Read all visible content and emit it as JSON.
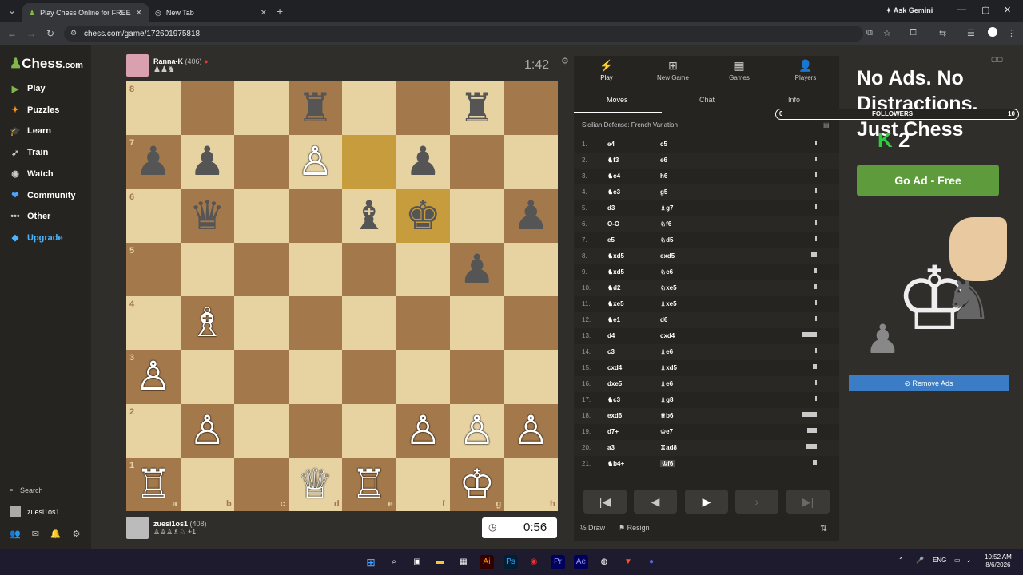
{
  "browser": {
    "tabs": [
      {
        "title": "Play Chess Online for FREE",
        "active": true
      },
      {
        "title": "New Tab",
        "active": false
      }
    ],
    "url": "chess.com/game/172601975818",
    "gemini": "Ask Gemini"
  },
  "sidebar": {
    "logo_main": "Chess",
    "logo_suffix": ".com",
    "items": [
      {
        "label": "Play",
        "icon": "play-icon"
      },
      {
        "label": "Puzzles",
        "icon": "puzzle-icon"
      },
      {
        "label": "Learn",
        "icon": "learn-icon"
      },
      {
        "label": "Train",
        "icon": "train-icon"
      },
      {
        "label": "Watch",
        "icon": "watch-icon"
      },
      {
        "label": "Community",
        "icon": "community-icon"
      },
      {
        "label": "Other",
        "icon": "more-icon"
      },
      {
        "label": "Upgrade",
        "icon": "diamond-icon"
      }
    ],
    "search": "Search",
    "username": "zuesi1os1"
  },
  "top_player": {
    "name": "Ranna-K",
    "rating": "(406)",
    "clock": "1:42"
  },
  "bottom_player": {
    "name": "zuesi1os1",
    "rating": "(408)",
    "extra": "+1",
    "clock": "0:56"
  },
  "board": {
    "ranks": [
      "8",
      "7",
      "6",
      "5",
      "4",
      "3",
      "2",
      "1"
    ],
    "files": [
      "a",
      "b",
      "c",
      "d",
      "e",
      "f",
      "g",
      "h"
    ],
    "highlight": [
      "e7",
      "f6"
    ],
    "pieces": [
      {
        "sq": "d8",
        "p": "♜",
        "c": "b"
      },
      {
        "sq": "g8",
        "p": "♜",
        "c": "b"
      },
      {
        "sq": "a7",
        "p": "♟",
        "c": "b"
      },
      {
        "sq": "b7",
        "p": "♟",
        "c": "b"
      },
      {
        "sq": "d7",
        "p": "♙",
        "c": "w"
      },
      {
        "sq": "f7",
        "p": "♟",
        "c": "b"
      },
      {
        "sq": "b6",
        "p": "♛",
        "c": "b"
      },
      {
        "sq": "e6",
        "p": "♝",
        "c": "b"
      },
      {
        "sq": "f6",
        "p": "♚",
        "c": "b"
      },
      {
        "sq": "h6",
        "p": "♟",
        "c": "b"
      },
      {
        "sq": "g5",
        "p": "♟",
        "c": "b"
      },
      {
        "sq": "b4",
        "p": "♗",
        "c": "w"
      },
      {
        "sq": "a3",
        "p": "♙",
        "c": "w"
      },
      {
        "sq": "b2",
        "p": "♙",
        "c": "w"
      },
      {
        "sq": "f2",
        "p": "♙",
        "c": "w"
      },
      {
        "sq": "g2",
        "p": "♙",
        "c": "w"
      },
      {
        "sq": "h2",
        "p": "♙",
        "c": "w"
      },
      {
        "sq": "a1",
        "p": "♖",
        "c": "w"
      },
      {
        "sq": "d1",
        "p": "♕",
        "c": "w"
      },
      {
        "sq": "e1",
        "p": "♖",
        "c": "w"
      },
      {
        "sq": "g1",
        "p": "♔",
        "c": "w"
      }
    ]
  },
  "panel": {
    "tabs": [
      {
        "label": "Play",
        "icon": "lightning-icon"
      },
      {
        "label": "New Game",
        "icon": "plus-icon"
      },
      {
        "label": "Games",
        "icon": "grid-icon"
      },
      {
        "label": "Players",
        "icon": "players-icon"
      }
    ],
    "subtabs": [
      "Moves",
      "Chat",
      "Info"
    ],
    "opening": "Sicilian Defense: French Variation",
    "moves": [
      {
        "n": "1.",
        "w": "e4",
        "b": "c5",
        "t": 0.1
      },
      {
        "n": "2.",
        "w": "♞f3",
        "b": "e6",
        "t": 0.1
      },
      {
        "n": "3.",
        "w": "♞c4",
        "b": "h6",
        "t": 0.1
      },
      {
        "n": "4.",
        "w": "♞c3",
        "b": "g5",
        "t": 0.1
      },
      {
        "n": "5.",
        "w": "d3",
        "b": "♗g7",
        "t": 0.1
      },
      {
        "n": "6.",
        "w": "O-O",
        "b": "♘f6",
        "t": 0.1
      },
      {
        "n": "7.",
        "w": "e5",
        "b": "♘d5",
        "t": 0.1
      },
      {
        "n": "8.",
        "w": "♞xd5",
        "b": "exd5",
        "t": 0.35
      },
      {
        "n": "9.",
        "w": "♞xd5",
        "b": "♘c6",
        "t": 0.15
      },
      {
        "n": "10.",
        "w": "♞d2",
        "b": "♘xe5",
        "t": 0.15
      },
      {
        "n": "11.",
        "w": "♞xe5",
        "b": "♗xe5",
        "t": 0.1
      },
      {
        "n": "12.",
        "w": "♞e1",
        "b": "d6",
        "t": 0.1
      },
      {
        "n": "13.",
        "w": "d4",
        "b": "cxd4",
        "t": 0.9
      },
      {
        "n": "14.",
        "w": "c3",
        "b": "♗e6",
        "t": 0.1
      },
      {
        "n": "15.",
        "w": "cxd4",
        "b": "♗xd5",
        "t": 0.25
      },
      {
        "n": "16.",
        "w": "dxe5",
        "b": "♗e6",
        "t": 0.1
      },
      {
        "n": "17.",
        "w": "♞c3",
        "b": "♗g8",
        "t": 0.1
      },
      {
        "n": "18.",
        "w": "exd6",
        "b": "♕b6",
        "t": 0.95
      },
      {
        "n": "19.",
        "w": "d7+",
        "b": "♔e7",
        "t": 0.6
      },
      {
        "n": "20.",
        "w": "a3",
        "b": "♖ad8",
        "t": 0.7
      },
      {
        "n": "21.",
        "w": "♞b4+",
        "b": "♔f6",
        "t": 0.25
      }
    ],
    "controls": [
      {
        "icon": "first-icon",
        "glyph": "|◀"
      },
      {
        "icon": "prev-icon",
        "glyph": "◀"
      },
      {
        "icon": "next-icon",
        "glyph": "▶"
      },
      {
        "icon": "next-disabled-icon",
        "glyph": "›"
      },
      {
        "icon": "last-icon",
        "glyph": "▶|"
      }
    ],
    "draw": "Draw",
    "resign": "Resign"
  },
  "ad": {
    "title": "No Ads. No Distractions. Just Chess",
    "followers_label": "FOLLOWERS",
    "followers_min": "0",
    "followers_max": "10",
    "followers_count": "2",
    "cta": "Go Ad - Free",
    "remove": "Remove Ads"
  },
  "taskbar": {
    "lang": "ENG",
    "time": "10:52 AM",
    "date": "8/6/2026"
  },
  "colors": {
    "light_sq": "#e7d2a2",
    "dark_sq": "#a3784b",
    "highlight": "#c79c3c",
    "accent": "#81b64c"
  }
}
